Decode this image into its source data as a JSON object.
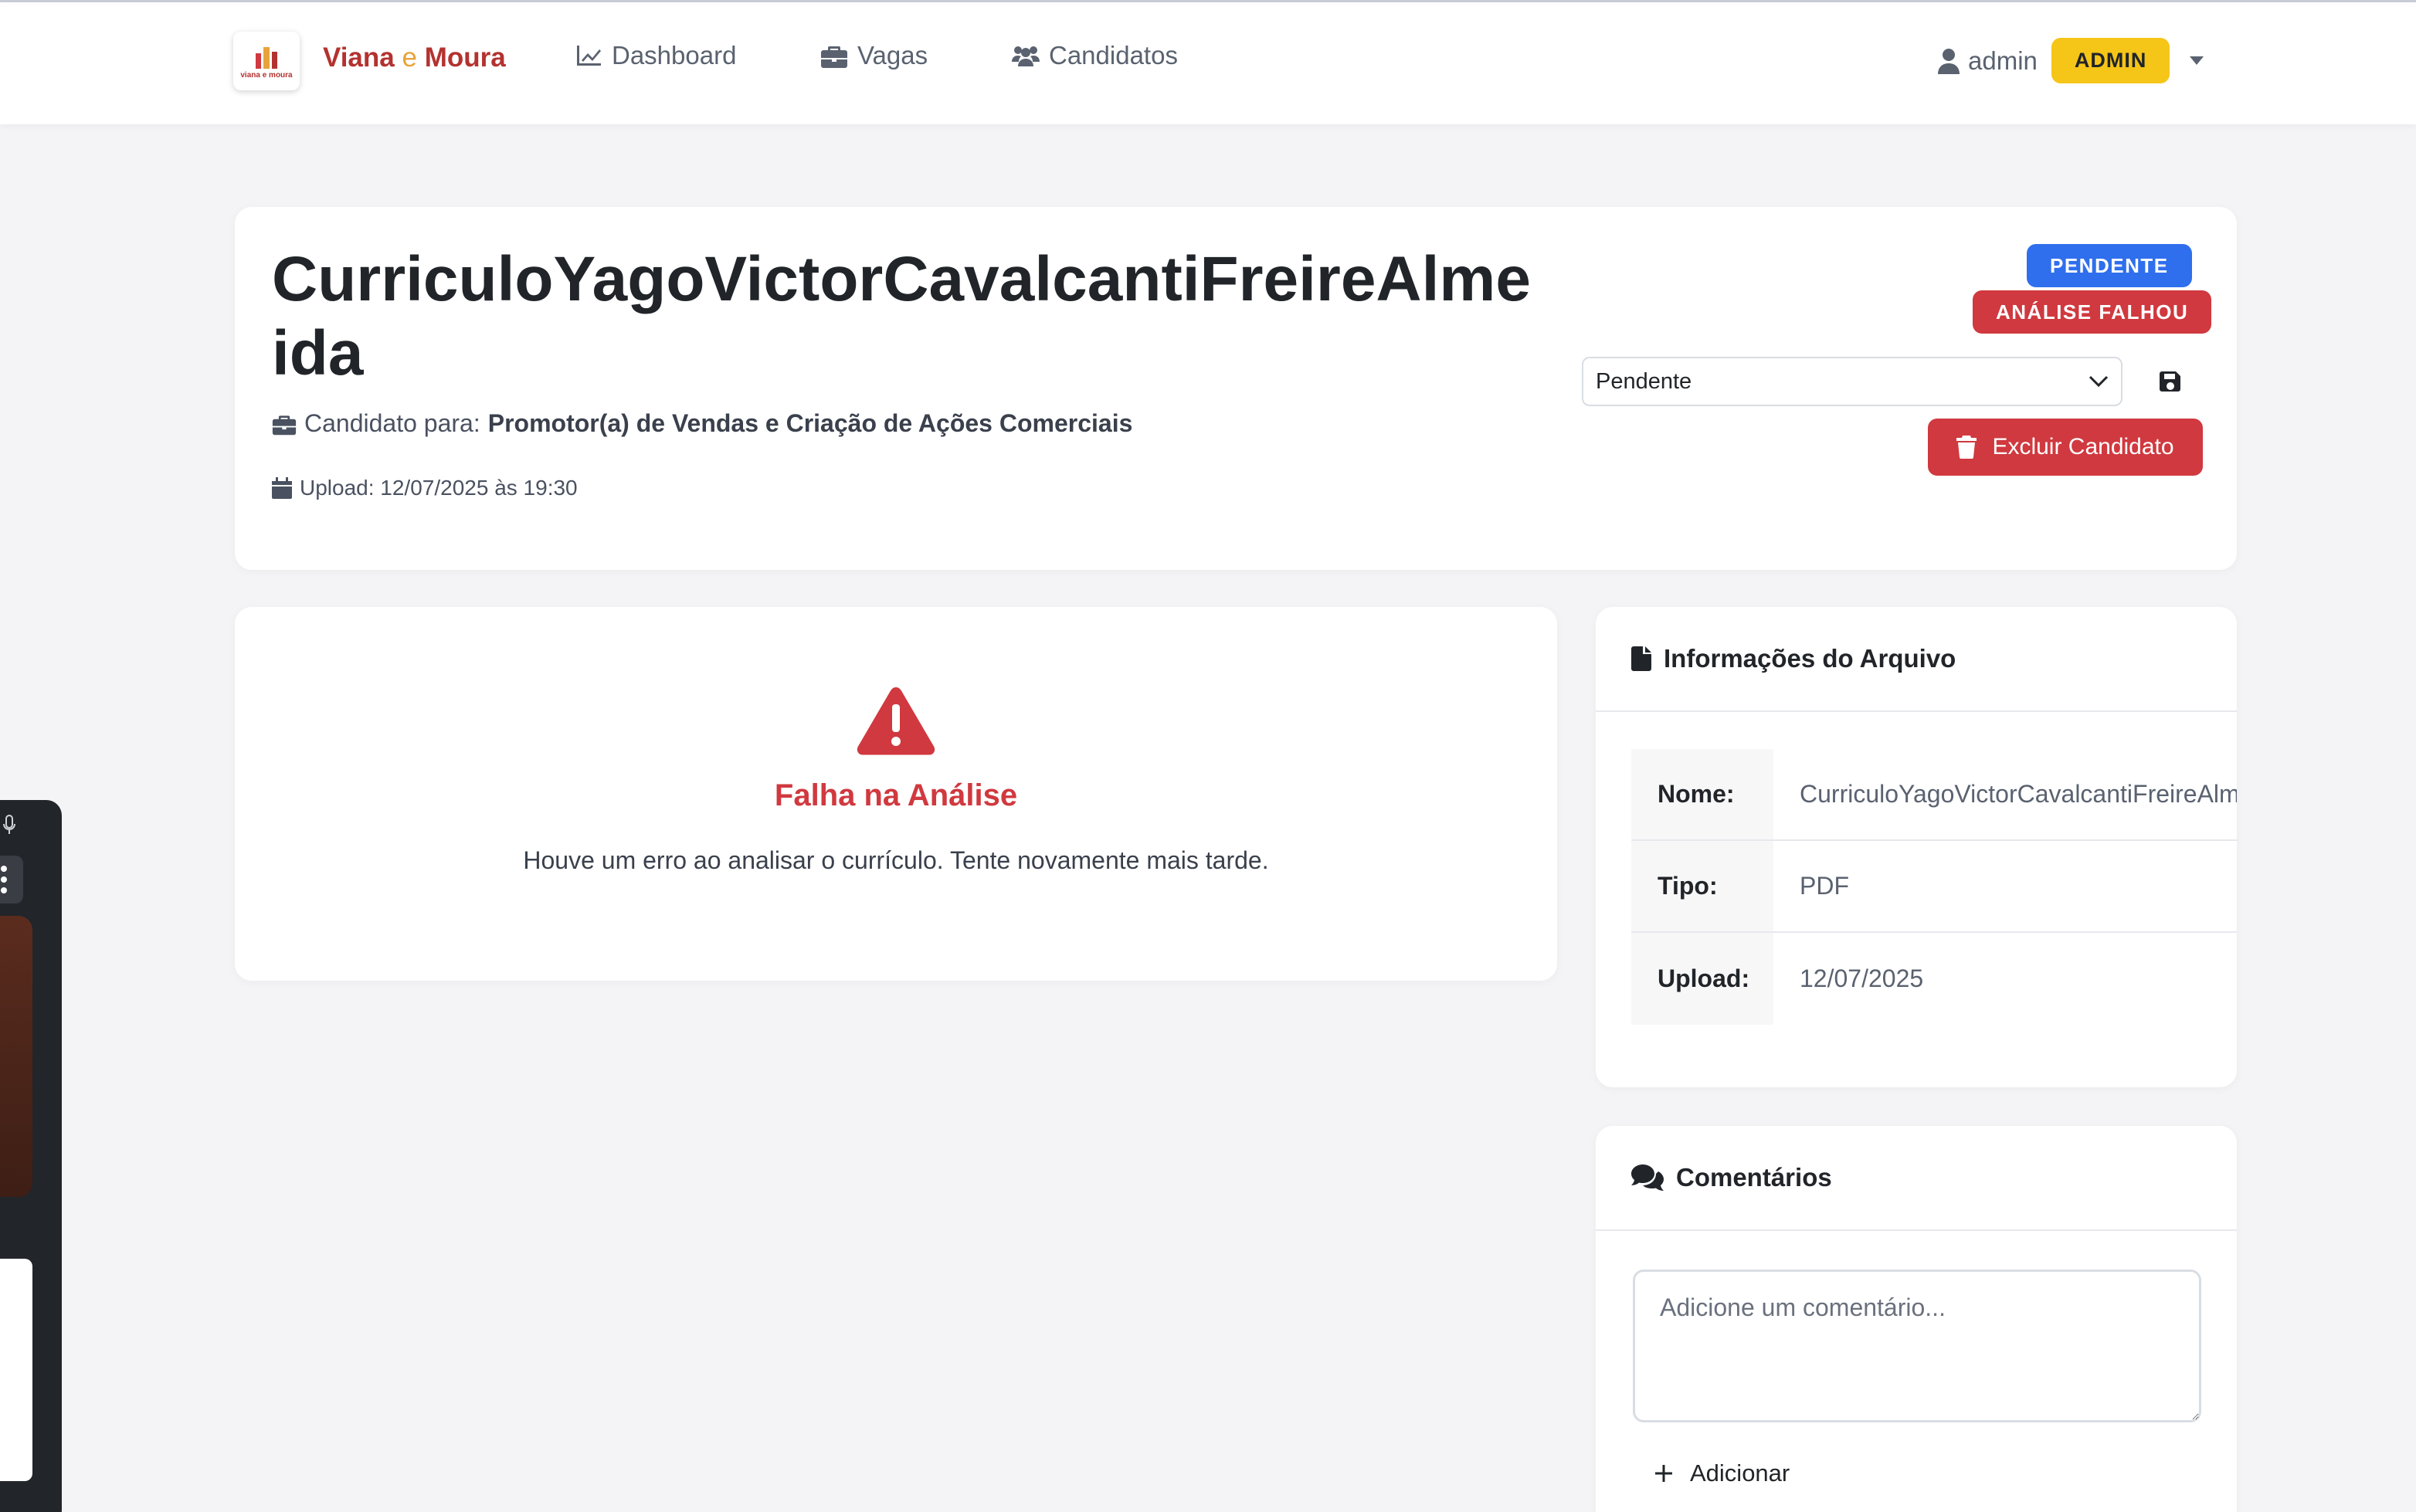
{
  "navbar": {
    "brand": {
      "part1": "Viana",
      "part2": "e",
      "part3": "Moura",
      "logo_text": "viana e moura"
    },
    "links": [
      {
        "label": "Dashboard",
        "icon": "chart-line-icon"
      },
      {
        "label": "Vagas",
        "icon": "briefcase-icon"
      },
      {
        "label": "Candidatos",
        "icon": "users-icon"
      }
    ],
    "user": {
      "name": "admin",
      "role_badge": "ADMIN"
    }
  },
  "candidate": {
    "title": "CurriculoYagoVictorCavalcantiFreireAlmeida",
    "candidate_for_label": "Candidato para:",
    "position": "Promotor(a) de Vendas e Criação de Ações Comerciais",
    "upload_text": "Upload: 12/07/2025 às 19:30",
    "status_badge": "PENDENTE",
    "analysis_badge": "ANÁLISE FALHOU",
    "status_select_value": "Pendente",
    "delete_label": "Excluir Candidato"
  },
  "analysis_error": {
    "title": "Falha na Análise",
    "message": "Houve um erro ao analisar o currículo. Tente novamente mais tarde."
  },
  "file_info": {
    "title": "Informações do Arquivo",
    "rows": [
      {
        "key": "Nome:",
        "value": "CurriculoYagoVictorCavalcantiFreireAlmeida"
      },
      {
        "key": "Tipo:",
        "value": "PDF"
      },
      {
        "key": "Upload:",
        "value": "12/07/2025"
      }
    ]
  },
  "comments": {
    "title": "Comentários",
    "placeholder": "Adicione um comentário...",
    "add_label": "Adicionar"
  },
  "colors": {
    "brand": "#b3322f",
    "brand_accent": "#e8a33a",
    "primary": "#2f6fed",
    "danger": "#d0393f",
    "warning": "#f5c518"
  }
}
